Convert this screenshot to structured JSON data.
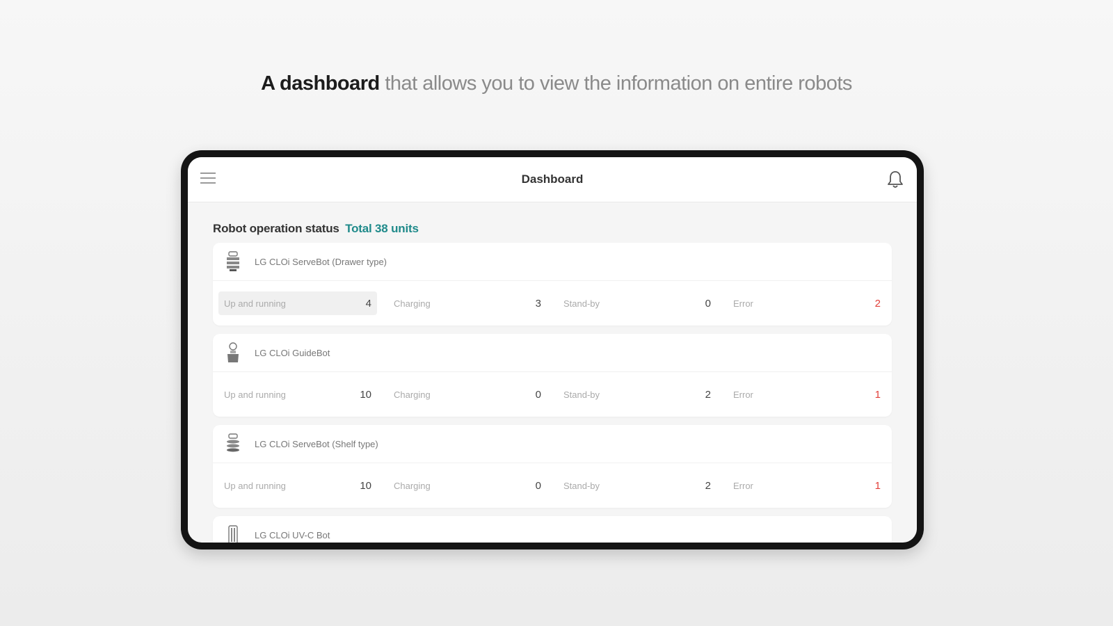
{
  "headline": {
    "bold": "A dashboard",
    "rest": "that allows you to view the information on entire robots"
  },
  "appbar": {
    "title": "Dashboard",
    "menu_icon": "hamburger-menu-icon",
    "notification_icon": "bell-icon"
  },
  "section": {
    "title": "Robot operation status",
    "total": "Total 38 units"
  },
  "robots": [
    {
      "name": "LG CLOi ServeBot (Drawer type)",
      "icon": "servebot-drawer-icon",
      "stats": [
        {
          "label": "Up and running",
          "value": "4"
        },
        {
          "label": "Charging",
          "value": "3"
        },
        {
          "label": "Stand-by",
          "value": "0"
        },
        {
          "label": "Error",
          "value": "2"
        }
      ]
    },
    {
      "name": "LG CLOi GuideBot",
      "icon": "guidebot-icon",
      "stats": [
        {
          "label": "Up and running",
          "value": "10"
        },
        {
          "label": "Charging",
          "value": "0"
        },
        {
          "label": "Stand-by",
          "value": "2"
        },
        {
          "label": "Error",
          "value": "1"
        }
      ]
    },
    {
      "name": "LG CLOi ServeBot (Shelf type)",
      "icon": "servebot-shelf-icon",
      "stats": [
        {
          "label": "Up and running",
          "value": "10"
        },
        {
          "label": "Charging",
          "value": "0"
        },
        {
          "label": "Stand-by",
          "value": "2"
        },
        {
          "label": "Error",
          "value": "1"
        }
      ]
    },
    {
      "name": "LG CLOi UV-C Bot",
      "icon": "uvc-bot-icon"
    }
  ],
  "colors": {
    "accent": "#1f8a8a",
    "error": "#e2403a"
  }
}
